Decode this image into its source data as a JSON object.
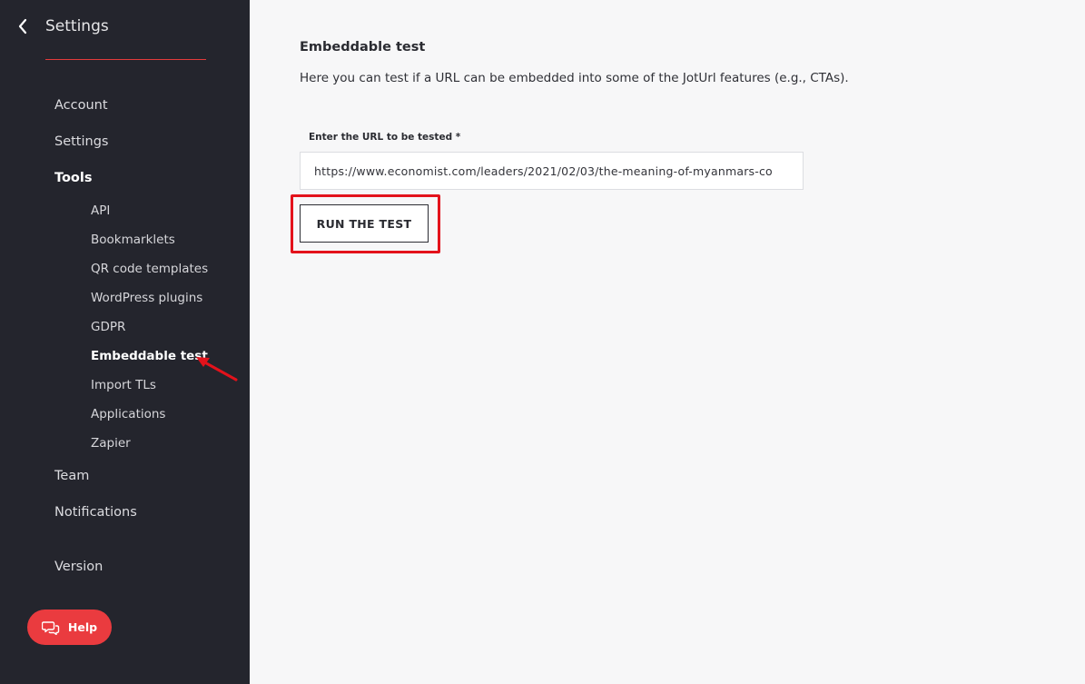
{
  "sidebar": {
    "title": "Settings",
    "items": [
      {
        "label": "Account"
      },
      {
        "label": "Settings"
      },
      {
        "label": "Tools"
      },
      {
        "label": "Team"
      },
      {
        "label": "Notifications"
      },
      {
        "label": "Version"
      }
    ],
    "tools_subitems": [
      {
        "label": "API"
      },
      {
        "label": "Bookmarklets"
      },
      {
        "label": "QR code templates"
      },
      {
        "label": "WordPress plugins"
      },
      {
        "label": "GDPR"
      },
      {
        "label": "Embeddable test"
      },
      {
        "label": "Import TLs"
      },
      {
        "label": "Applications"
      },
      {
        "label": "Zapier"
      }
    ],
    "help_label": "Help"
  },
  "main": {
    "title": "Embeddable test",
    "description": "Here you can test if a URL can be embedded into some of the JotUrl features (e.g., CTAs).",
    "url_label": "Enter the URL to be tested *",
    "url_value": "https://www.economist.com/leaders/2021/02/03/the-meaning-of-myanmars-co",
    "run_button": "RUN THE TEST"
  },
  "colors": {
    "sidebar_bg": "#24252d",
    "accent_red": "#ea3b3f",
    "highlight_red": "#e3121b",
    "main_bg": "#f7f7f8"
  },
  "icons": {
    "back": "chevron-left-icon",
    "help": "chat-bubbles-icon"
  }
}
